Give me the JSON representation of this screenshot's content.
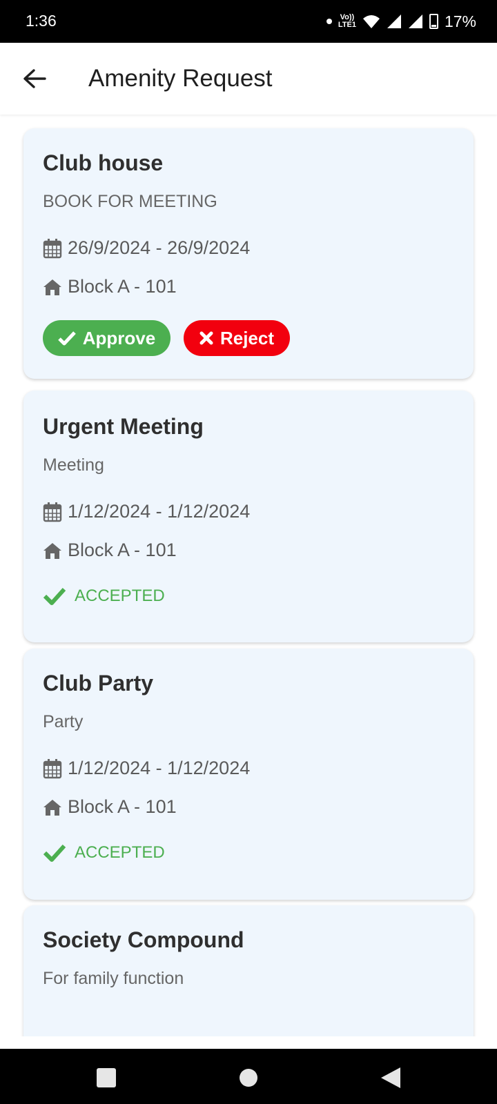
{
  "status_bar": {
    "time": "1:36",
    "volte": "Vo)) LTE1",
    "battery": "17%"
  },
  "app_bar": {
    "title": "Amenity Request"
  },
  "requests": [
    {
      "title": "Club house",
      "subtitle": "BOOK FOR MEETING",
      "dates": "26/9/2024 - 26/9/2024",
      "unit": "Block A - 101",
      "approve_label": "Approve",
      "reject_label": "Reject"
    },
    {
      "title": " Urgent Meeting",
      "subtitle": "Meeting",
      "dates": "1/12/2024 - 1/12/2024",
      "unit": "Block A - 101",
      "status": "ACCEPTED"
    },
    {
      "title": "Club Party",
      "subtitle": "Party",
      "dates": "1/12/2024 - 1/12/2024",
      "unit": "Block A - 101",
      "status": "ACCEPTED"
    },
    {
      "title": "Society Compound",
      "subtitle": "For family function"
    }
  ],
  "colors": {
    "approve": "#4caf50",
    "reject": "#f2000e",
    "accepted": "#4caf50",
    "card_bg": "#eff6fd"
  },
  "icons": [
    "back-arrow-icon",
    "calendar-icon",
    "home-icon",
    "check-icon",
    "close-icon",
    "square-icon",
    "circle-icon",
    "triangle-back-icon"
  ]
}
